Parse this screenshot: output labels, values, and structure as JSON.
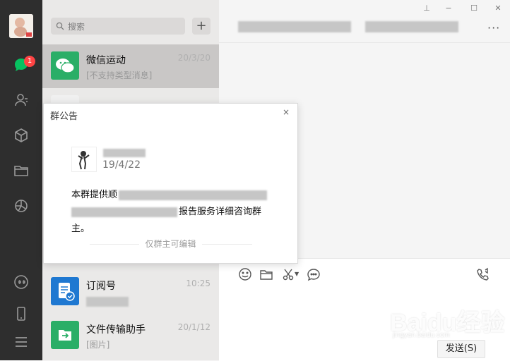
{
  "search": {
    "placeholder": "搜索"
  },
  "sidebar": {
    "unread_badge": "1"
  },
  "chats": [
    {
      "name": "微信运动",
      "time": "20/3/20",
      "message": "[不支持类型消息]",
      "icon": "wechat-sport-icon",
      "color": "#2aae67"
    },
    {
      "name": "订阅号",
      "time": "10:25",
      "message": "",
      "icon": "subscription-icon",
      "color": "#1f78d1"
    },
    {
      "name": "文件传输助手",
      "time": "20/1/12",
      "message": "[图片]",
      "icon": "file-transfer-icon",
      "color": "#2aae67"
    }
  ],
  "popup": {
    "title": "群公告",
    "close": "×",
    "date": "19/4/22",
    "body_line1": "本群提供顺",
    "body_line2": "报告服务详细咨询群",
    "body_line3": "主。",
    "footer": "仅群主可编辑"
  },
  "window": {
    "pin": "⊥",
    "minimize": "−",
    "maximize": "☐",
    "close": "✕",
    "more": "···"
  },
  "input": {
    "send_label": "发送(S)"
  },
  "watermark": {
    "main": "Baidu经验",
    "sub": "jingyan.baidu.com"
  }
}
